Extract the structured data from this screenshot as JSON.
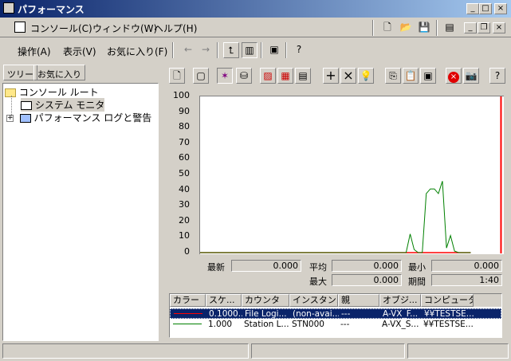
{
  "window": {
    "title": "パフォーマンス"
  },
  "mdi_menu": [
    "コンソール(C)",
    "ウィンドウ(W)",
    "ヘルプ(H)"
  ],
  "action_menu": [
    "操作(A)",
    "表示(V)",
    "お気に入り(F)"
  ],
  "tabs": [
    "ツリー",
    "お気に入り"
  ],
  "tree": {
    "items": [
      {
        "label": "コンソール ルート",
        "icon": "folder-icon"
      },
      {
        "label": "システム モニタ",
        "icon": "system-monitor-icon"
      },
      {
        "label": "パフォーマンス ログと警告",
        "icon": "perf-logs-icon"
      }
    ]
  },
  "chart_data": {
    "type": "line",
    "title": "",
    "xlabel": "",
    "ylabel": "",
    "ylim": [
      0,
      100
    ],
    "yticks": [
      "100",
      "90",
      "80",
      "70",
      "60",
      "50",
      "40",
      "30",
      "20",
      "10",
      "0"
    ],
    "grid": false,
    "x": [
      0,
      10,
      20,
      30,
      40,
      50,
      60,
      70,
      80,
      90,
      100,
      102,
      104,
      106,
      108,
      110,
      112,
      114,
      116,
      118,
      120,
      122,
      124,
      126,
      128,
      130,
      132,
      134
    ],
    "series": [
      {
        "color": "#ff0000",
        "values": [
          0,
          0,
          0,
          0,
          0,
          0,
          0,
          0,
          0,
          0,
          0,
          0,
          0,
          0,
          0,
          0,
          0,
          0,
          0,
          0,
          0,
          0,
          0,
          0,
          0,
          0,
          0,
          0
        ]
      },
      {
        "color": "#008000",
        "values": [
          0,
          0,
          0,
          0,
          0,
          0,
          0,
          0,
          0,
          0,
          0,
          0,
          12,
          2,
          0,
          0,
          38,
          41,
          41,
          38,
          46,
          3,
          11,
          1,
          0,
          0,
          0,
          0
        ]
      }
    ],
    "time_bar": {
      "color": "#ff0000",
      "x": 149,
      "x_range": [
        0,
        150
      ]
    }
  },
  "stats": {
    "latest_label": "最新",
    "latest": "0.000",
    "average_label": "平均",
    "average": "0.000",
    "min_label": "最小",
    "min": "0.000",
    "max_label": "最大",
    "max": "0.000",
    "duration_label": "期間",
    "duration": "1:40"
  },
  "counter_table": {
    "headers": [
      "カラー",
      "スケ...",
      "カウンタ",
      "インスタン...",
      "親",
      "オブジ...",
      "コンピュータ"
    ],
    "rows": [
      {
        "color": "#ff0000",
        "scale": "0.1000...",
        "counter": "File Logi...",
        "instance": "(non-avai...",
        "parent": "---",
        "object": "A-VX_F...",
        "computer": "¥¥TESTSE...",
        "selected": true
      },
      {
        "color": "#008000",
        "scale": "1.000",
        "counter": "Station L...",
        "instance": "STN000",
        "parent": "---",
        "object": "A-VX_S...",
        "computer": "¥¥TESTSE...",
        "selected": false
      }
    ]
  }
}
